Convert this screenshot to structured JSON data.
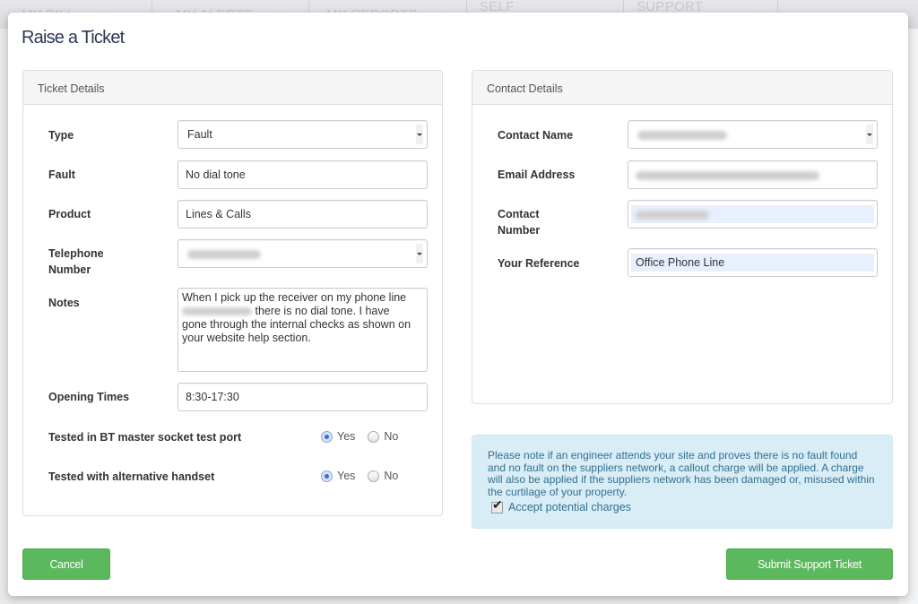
{
  "background_nav": {
    "items": [
      {
        "label": "My Bill"
      },
      {
        "label": "My Alerts"
      },
      {
        "label": "My Reports"
      },
      {
        "label": "Self Service"
      },
      {
        "label": "Support Centre"
      }
    ]
  },
  "modal": {
    "title": "Raise a Ticket"
  },
  "ticket_details": {
    "heading": "Ticket Details",
    "type": {
      "label": "Type",
      "value": "Fault"
    },
    "fault": {
      "label": "Fault",
      "value": "No dial tone"
    },
    "product": {
      "label": "Product",
      "value": "Lines & Calls"
    },
    "telephone_number": {
      "label_line1": "Telephone",
      "label_line2": "Number",
      "value": "[redacted]"
    },
    "notes": {
      "label": "Notes",
      "value_line1": "When I pick up the receiver on my phone line",
      "value_line2": " there is no dial tone. I have",
      "value_line3": "gone through the internal checks as shown on",
      "value_line4": "your website help section."
    },
    "opening_times": {
      "label": "Opening Times",
      "value": "8:30-17:30"
    },
    "tested_master_socket": {
      "label": "Tested in BT master socket test port",
      "options": [
        "Yes",
        "No"
      ],
      "selected": "Yes"
    },
    "tested_alt_handset": {
      "label": "Tested with alternative handset",
      "options": [
        "Yes",
        "No"
      ],
      "selected": "Yes"
    }
  },
  "contact_details": {
    "heading": "Contact Details",
    "contact_name": {
      "label": "Contact Name",
      "value": "[redacted]"
    },
    "email": {
      "label": "Email Address",
      "value": "[redacted]"
    },
    "contact_number": {
      "label_line1": "Contact",
      "label_line2": "Number",
      "value": "[redacted]"
    },
    "your_reference": {
      "label": "Your Reference",
      "value": "Office Phone Line"
    }
  },
  "notice": {
    "text": "Please note if an engineer attends your site and proves there is no fault found and no fault on the suppliers network, a callout charge will be applied. A charge will also be applied if the suppliers network has been damaged or, misused within the curtilage of your property.",
    "checkbox_label": "Accept potential charges",
    "checked": true
  },
  "buttons": {
    "cancel": "Cancel",
    "submit": "Submit Support Ticket"
  },
  "colors": {
    "primary_button": "#5cb85c",
    "alert_bg": "#d9edf7",
    "alert_text": "#31708f",
    "title": "#2b3a55"
  }
}
